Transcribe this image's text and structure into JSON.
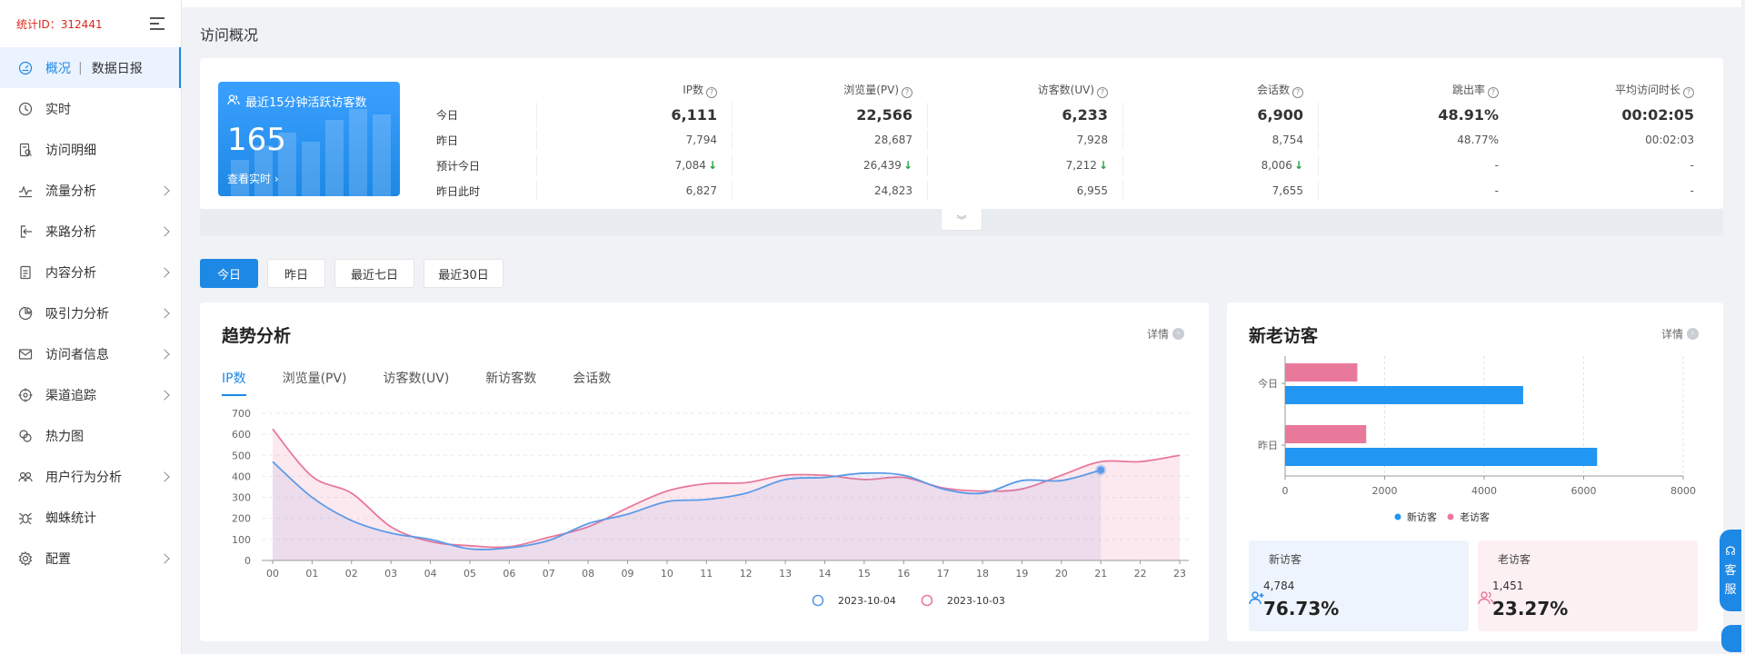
{
  "sidebar": {
    "stat_id": "统计ID：312441",
    "items": [
      {
        "label": "概况",
        "sub": "数据日报",
        "active": true,
        "arrow": false
      },
      {
        "label": "实时",
        "arrow": false
      },
      {
        "label": "访问明细",
        "arrow": false
      },
      {
        "label": "流量分析",
        "arrow": true
      },
      {
        "label": "来路分析",
        "arrow": true
      },
      {
        "label": "内容分析",
        "arrow": true
      },
      {
        "label": "吸引力分析",
        "arrow": true
      },
      {
        "label": "访问者信息",
        "arrow": true
      },
      {
        "label": "渠道追踪",
        "arrow": true
      },
      {
        "label": "热力图",
        "arrow": false
      },
      {
        "label": "用户行为分析",
        "arrow": true
      },
      {
        "label": "蜘蛛统计",
        "arrow": false
      },
      {
        "label": "配置",
        "arrow": true
      }
    ]
  },
  "page_title": "访问概况",
  "live": {
    "title": "最近15分钟活跃访客数",
    "value": "165",
    "link": "查看实时"
  },
  "stats": {
    "columns": [
      "IP数",
      "浏览量(PV)",
      "访客数(UV)",
      "会话数",
      "跳出率",
      "平均访问时长"
    ],
    "rows": [
      {
        "label": "今日",
        "values": [
          "6,111",
          "22,566",
          "6,233",
          "6,900",
          "48.91%",
          "00:02:05"
        ],
        "big": true
      },
      {
        "label": "昨日",
        "values": [
          "7,794",
          "28,687",
          "7,928",
          "8,754",
          "48.77%",
          "00:02:03"
        ]
      },
      {
        "label": "预计今日",
        "values": [
          "7,084",
          "26,439",
          "7,212",
          "8,006",
          "-",
          "-"
        ],
        "down": [
          true,
          true,
          true,
          true,
          false,
          false
        ]
      },
      {
        "label": "昨日此时",
        "values": [
          "6,827",
          "24,823",
          "6,955",
          "7,655",
          "-",
          "-"
        ]
      }
    ]
  },
  "periods": [
    "今日",
    "昨日",
    "最近七日",
    "最近30日"
  ],
  "trend": {
    "title": "趋势分析",
    "detail": "详情",
    "tabs": [
      "IP数",
      "浏览量(PV)",
      "访客数(UV)",
      "新访客数",
      "会话数"
    ]
  },
  "visitors": {
    "title": "新老访客",
    "detail": "详情",
    "new_label": "新访客",
    "old_label": "老访客",
    "new_count": "4,784",
    "old_count": "1,451",
    "new_pct": "76.73%",
    "old_pct": "23.27%"
  },
  "float_service": [
    "客",
    "服"
  ],
  "colors": {
    "accent": "#1e88e5",
    "new": "#2196f3",
    "old": "#e8799a",
    "today_line": "#5b9be8",
    "yesterday_line": "#e8799a"
  },
  "chart_data": [
    {
      "type": "line",
      "x": [
        "00",
        "01",
        "02",
        "03",
        "04",
        "05",
        "06",
        "07",
        "08",
        "09",
        "10",
        "11",
        "12",
        "13",
        "14",
        "15",
        "16",
        "17",
        "18",
        "19",
        "20",
        "21",
        "22",
        "23"
      ],
      "ylim": [
        0,
        700
      ],
      "yticks": [
        0,
        100,
        200,
        300,
        400,
        500,
        600,
        700
      ],
      "series": [
        {
          "name": "2023-10-04",
          "values": [
            470,
            300,
            190,
            130,
            100,
            55,
            60,
            95,
            175,
            220,
            280,
            290,
            320,
            385,
            395,
            415,
            405,
            340,
            320,
            380,
            380,
            430
          ]
        },
        {
          "name": "2023-10-03",
          "values": [
            625,
            400,
            320,
            160,
            90,
            70,
            65,
            110,
            160,
            250,
            330,
            365,
            370,
            405,
            405,
            385,
            395,
            345,
            330,
            340,
            405,
            470,
            470,
            500
          ]
        }
      ],
      "legend": "bottom"
    },
    {
      "type": "bar",
      "orientation": "horizontal",
      "categories": [
        "今日",
        "昨日"
      ],
      "xlim": [
        0,
        8000
      ],
      "xticks": [
        0,
        2000,
        4000,
        6000,
        8000
      ],
      "series": [
        {
          "name": "新访客",
          "values": [
            4784,
            6270
          ]
        },
        {
          "name": "老访客",
          "values": [
            1451,
            1630
          ]
        }
      ],
      "legend": "bottom"
    }
  ]
}
